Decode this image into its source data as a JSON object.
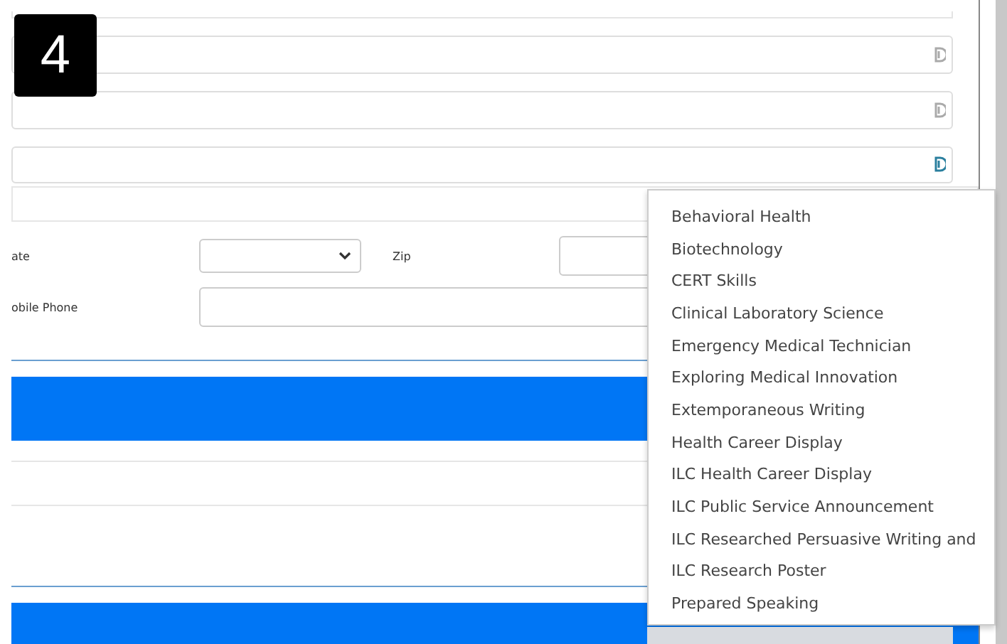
{
  "step_badge": "4",
  "top_fields": [
    {
      "icon_active": false
    },
    {
      "icon_active": false
    },
    {
      "icon_active": true
    }
  ],
  "address_rows": [
    {
      "kind": "select",
      "label": "ate",
      "second_label": "Zip"
    },
    {
      "kind": "text",
      "label": "obile Phone"
    }
  ],
  "dropdown": {
    "options": [
      {
        "label": "Behavioral Health"
      },
      {
        "label": "Biotechnology"
      },
      {
        "label": "CERT Skills"
      },
      {
        "label": "Clinical Laboratory Science"
      },
      {
        "label": "Emergency Medical Technician"
      },
      {
        "label": "Exploring Medical Innovation"
      },
      {
        "label": "Extemporaneous Writing"
      },
      {
        "label": "Health Career Display"
      },
      {
        "label": "ILC Health Career Display"
      },
      {
        "label": "ILC Public Service Announcement"
      },
      {
        "label": "ILC Researched Persuasive Writing and"
      },
      {
        "label": "ILC Research Poster"
      },
      {
        "label": "Prepared Speaking"
      }
    ]
  }
}
